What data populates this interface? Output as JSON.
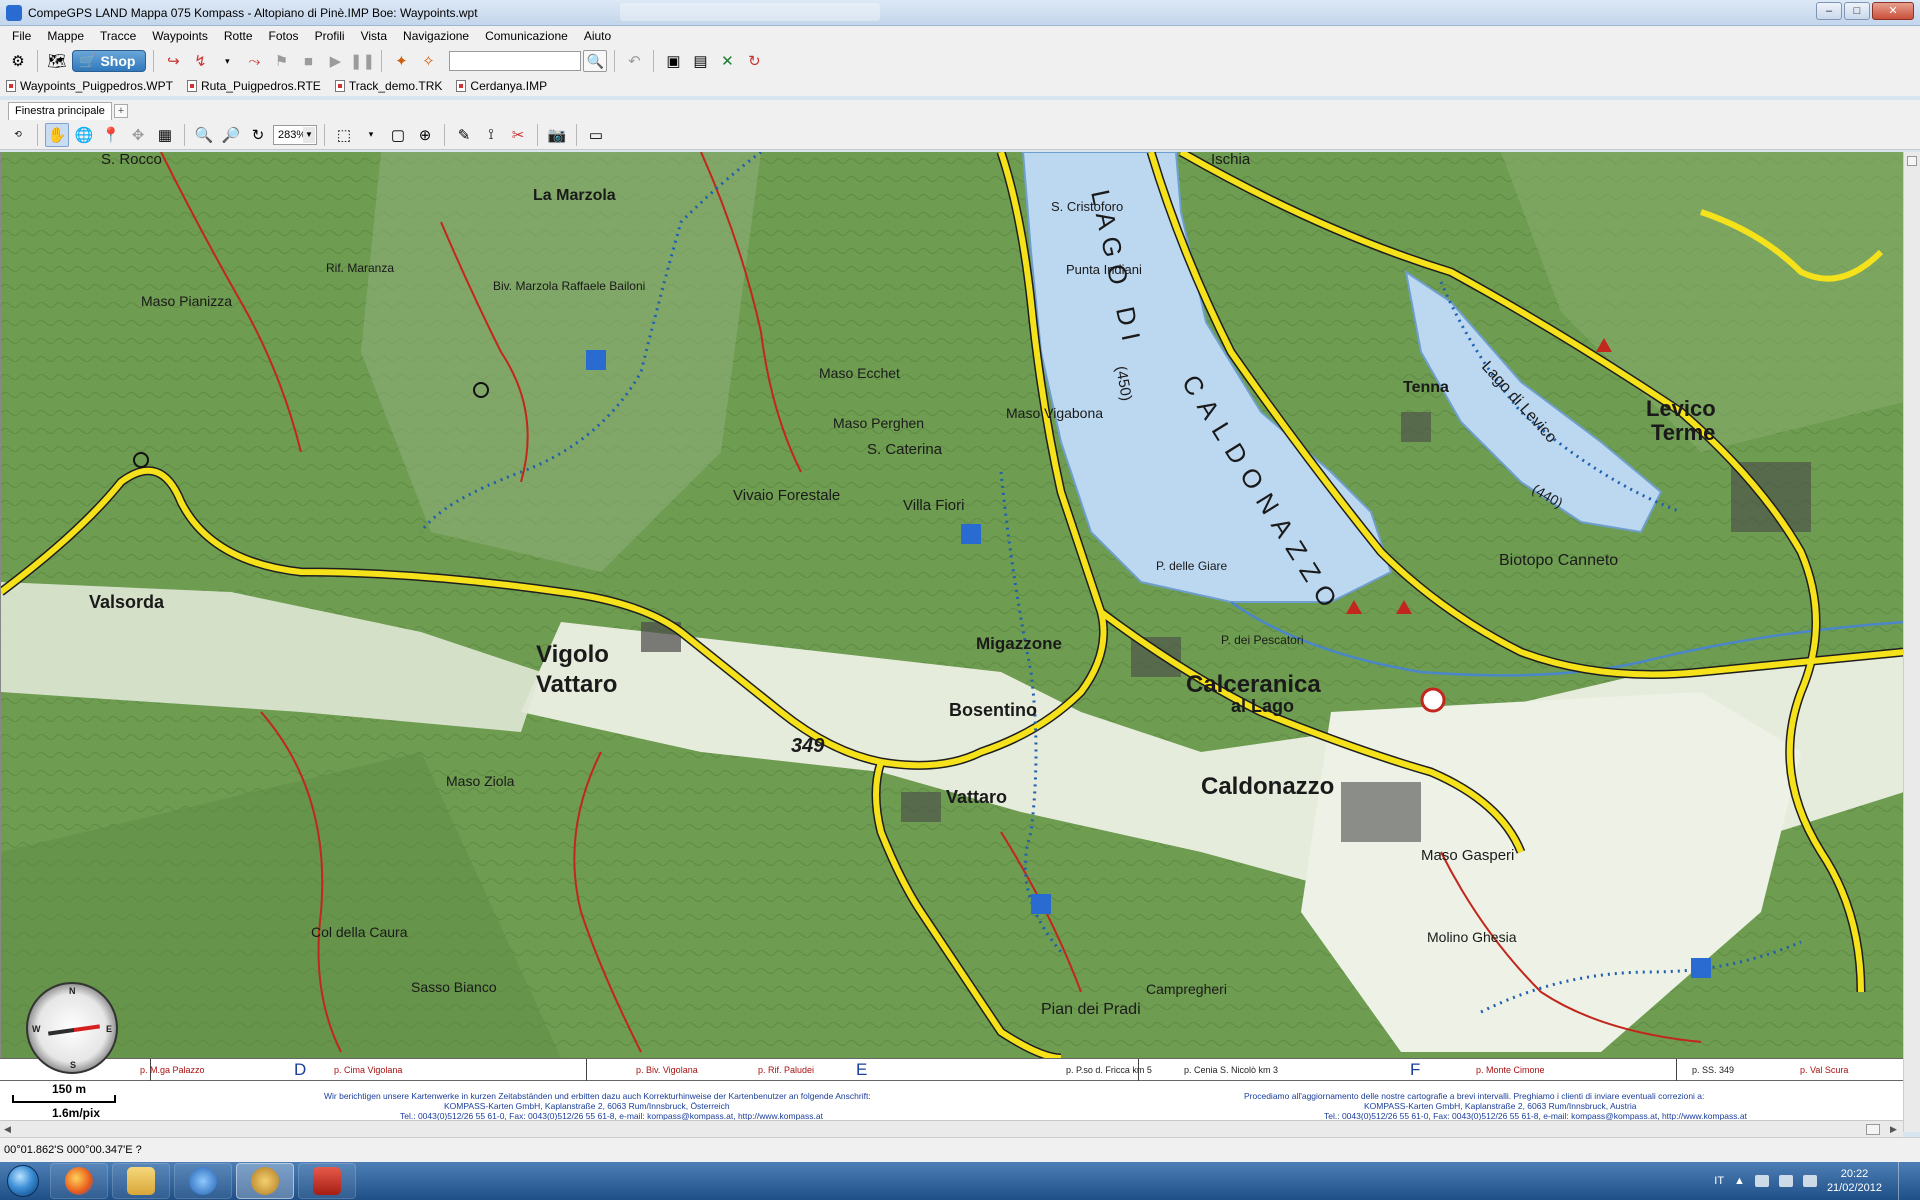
{
  "window": {
    "title": "CompeGPS LAND Mappa 075 Kompass - Altopiano di Pinè.IMP Boe:  Waypoints.wpt",
    "controls": {
      "minimize": "–",
      "maximize": "□",
      "close": "✕"
    }
  },
  "menu": [
    "File",
    "Mappe",
    "Tracce",
    "Waypoints",
    "Rotte",
    "Fotos",
    "Profili",
    "Vista",
    "Navigazione",
    "Comunicazione",
    "Aiuto"
  ],
  "toolbar": {
    "shop_label": "Shop",
    "search_placeholder": ""
  },
  "open_files": [
    "Waypoints_Puigpedros.WPT",
    "Ruta_Puigpedros.RTE",
    "Track_demo.TRK",
    "Cerdanya.IMP"
  ],
  "tabs": {
    "active": "Finestra principale",
    "add": "+"
  },
  "map_toolbar": {
    "zoom_value": "283%"
  },
  "map": {
    "labels": {
      "lago_di": "LAGO DI",
      "caldonazzo_lake": "CALDONAZZO",
      "lake_elev": "(450)",
      "lago_levico": "Lago di Levico",
      "levico_elev": "(440)",
      "vigolo": "Vigolo",
      "vattaro": "Vattaro",
      "bosentino": "Bosentino",
      "vattaro2": "Vattaro",
      "calceranica": "Calceranica",
      "al_lago": "al Lago",
      "caldonazzo": "Caldonazzo",
      "levico": "Levico",
      "terme": "Terme",
      "tenna": "Tenna",
      "migazzone": "Migazzone",
      "valsorda": "Valsorda",
      "marzola": "La Marzola",
      "maso_vigabona": "Maso Vigabona",
      "s_caterina": "S. Caterina",
      "villa_fiori": "Villa Fiori",
      "vivaio": "Vivaio Forestale",
      "biotopo": "Biotopo Canneto",
      "s_cristoforo": "S. Cristoforo",
      "punta_indiani": "Punta Indiani",
      "road_349": "349",
      "maso_pianizza": "Maso Pianizza",
      "rocco": "S. Rocco",
      "ischia": "Ischia",
      "maso_gasperi": "Maso Gasperi",
      "pian_dei_pradi": "Pian dei Pradi",
      "maso_ziola": "Maso Ziola",
      "marzola_hut": "Biv. Marzola Raffaele Bailoni",
      "rif_maranza": "Rif. Maranza",
      "sasso_bianco": "Sasso Bianco",
      "col_caura": "Col della Caura",
      "molino_ghesia": "Molino Ghesia",
      "calpregheri": "Campregheri",
      "maso_ecchet": "Maso Ecchet",
      "perghen": "Maso Perghen",
      "p_giare": "P. delle Giare",
      "p_pescatori": "P. dei Pescatori"
    },
    "strip": {
      "letters": [
        "D",
        "E",
        "F"
      ],
      "rules": [
        "p. M.ga Palazzo",
        "p. Cima Vigolana",
        "p. Biv. Vigolana",
        "p. Rif. Paludei",
        "p. P.so d. Fricca km 5",
        "p. Cenia S. Nicolò km 3",
        "p. Monte Cimone",
        "p. SS. 349",
        "p. Val Scura"
      ],
      "notice_left_1": "Wir berichtigen unsere Kartenwerke in kurzen Zeitabständen und erbitten dazu auch Korrekturhinweise der Kartenbenutzer an folgende Anschrift:",
      "notice_left_2": "KOMPASS-Karten GmbH, Kaplanstraße 2, 6063 Rum/Innsbruck, Österreich",
      "notice_left_3": "Tel.: 0043(0)512/26 55 61-0, Fax: 0043(0)512/26 55 61-8, e-mail: kompass@kompass.at, http://www.kompass.at",
      "notice_right_1": "Procediamo all'aggiornamento delle nostre cartografie a brevi intervalli. Preghiamo i clienti di inviare eventuali correzioni a:",
      "notice_right_2": "KOMPASS-Karten GmbH, Kaplanstraße 2, 6063 Rum/Innsbruck, Austria",
      "notice_right_3": "Tel.: 0043(0)512/26 55 61-0, Fax: 0043(0)512/26 55 61-8, e-mail: kompass@kompass.at, http://www.kompass.at"
    },
    "scale_distance": "150 m",
    "scale_resolution": "1.6m/pix",
    "compass_letters": {
      "n": "N",
      "s": "S",
      "e": "E",
      "w": "W"
    },
    "colors": {
      "forest": "#6c9a4f",
      "water": "#bcd8f0",
      "road": "#f6e21a",
      "valley": "#e8efe0"
    }
  },
  "status": {
    "coordinates": "00°01.862'S 000°00.347'E  ?"
  },
  "taskbar": {
    "apps": [
      "start-orb",
      "firefox-icon",
      "explorer-icon",
      "media-player-icon",
      "compegps-icon",
      "acrobat-icon"
    ],
    "language": "IT",
    "time": "20:22",
    "date": "21/02/2012"
  }
}
